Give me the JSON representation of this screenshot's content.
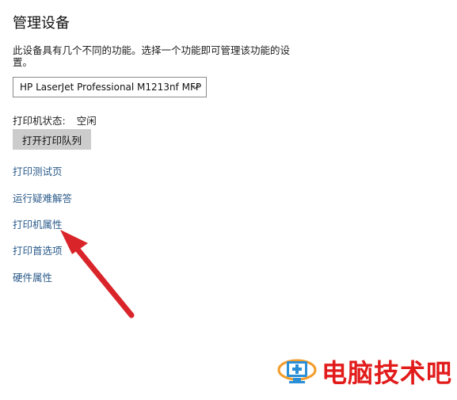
{
  "header": {
    "title": "管理设备",
    "description": "此设备具有几个不同的功能。选择一个功能即可管理该功能的设置。"
  },
  "device_select": {
    "selected": "HP LaserJet Professional M1213nf MFP",
    "chevron_icon": "chevron-down-icon"
  },
  "printer_status": {
    "label": "打印机状态:",
    "value": "空闲"
  },
  "open_queue_button": {
    "label": "打开打印队列"
  },
  "links": [
    {
      "label": "打印测试页"
    },
    {
      "label": "运行疑难解答"
    },
    {
      "label": "打印机属性"
    },
    {
      "label": "打印首选项"
    },
    {
      "label": "硬件属性"
    }
  ],
  "annotation": {
    "arrow_color": "#d9252a"
  },
  "watermark": {
    "text": "电脑技术吧",
    "color": "#e21b1b",
    "logo_icon": "monitor-plus-icon"
  }
}
